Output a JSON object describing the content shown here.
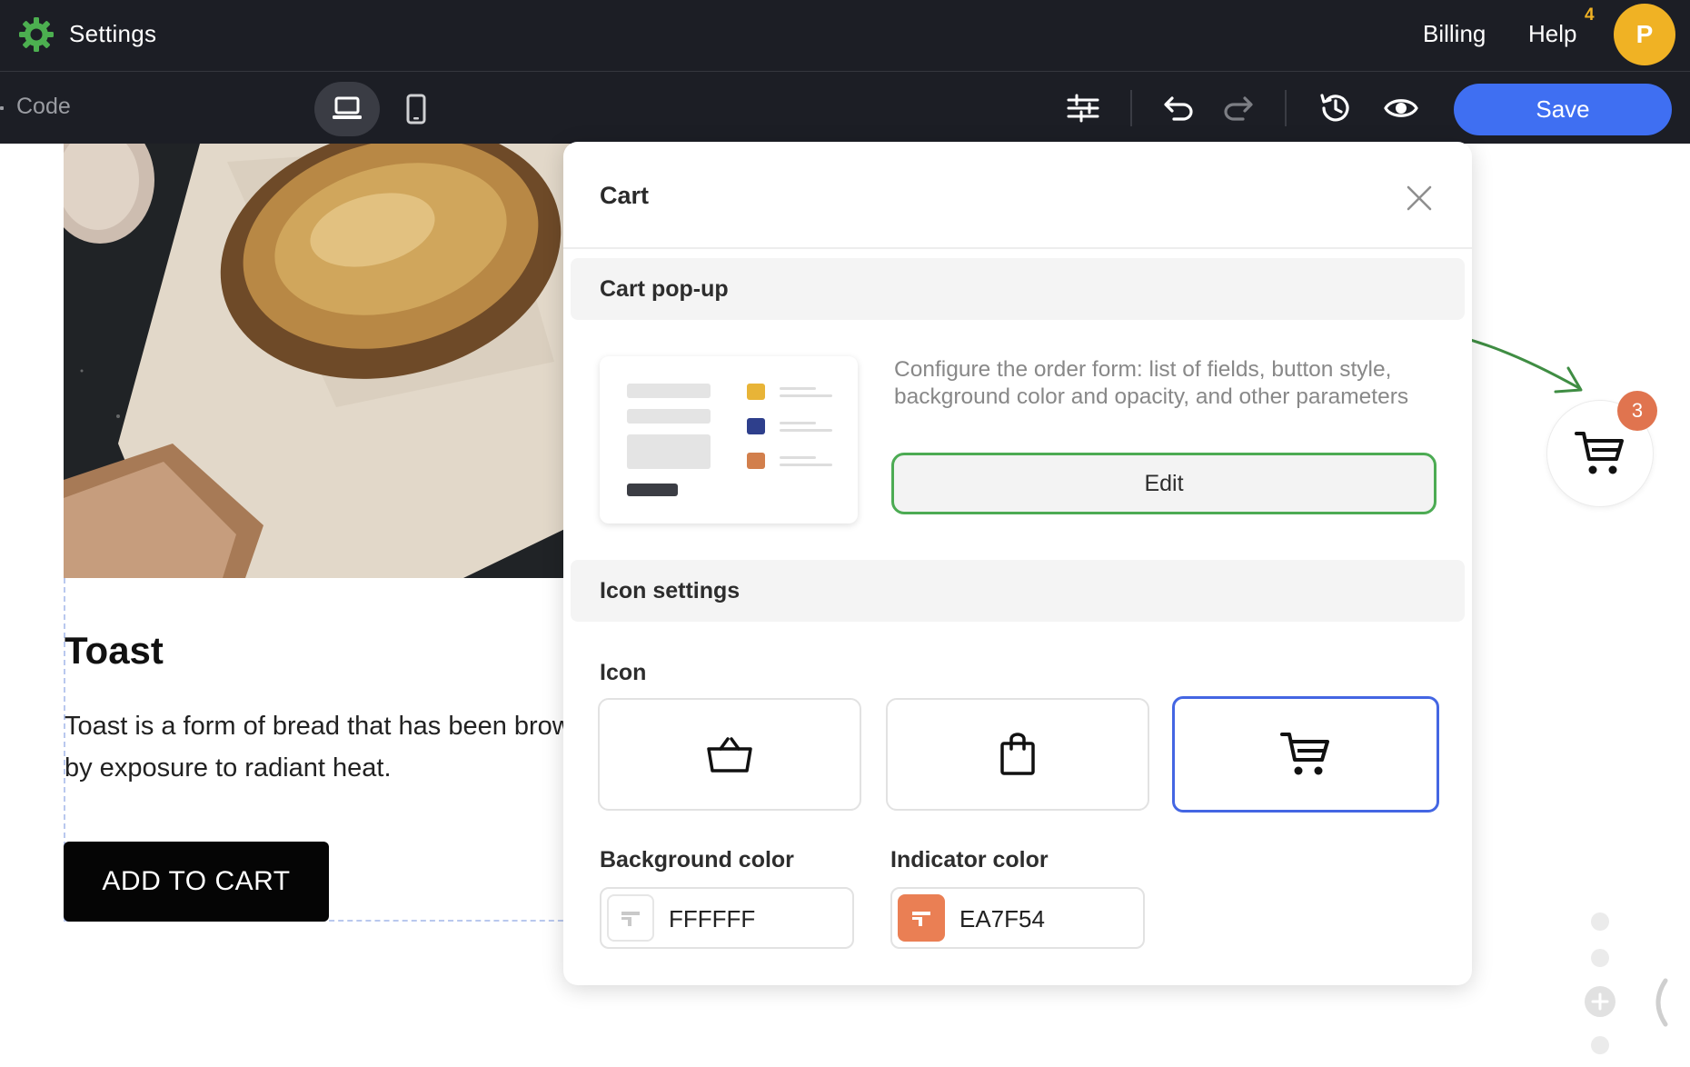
{
  "topbar": {
    "title": "Settings",
    "billing": "Billing",
    "help": "Help",
    "help_badge": "4",
    "avatar_letter": "P",
    "brand_color": "#4caf50"
  },
  "toolbar": {
    "code_tab": "Code",
    "save_label": "Save",
    "save_color": "#3f6ff2"
  },
  "product": {
    "title": "Toast",
    "description": "Toast is a form of bread that has been browned by exposure to radiant heat.",
    "button_label": "ADD TO CART"
  },
  "cart_widget": {
    "count": "3",
    "indicator_color": "#EA7F54"
  },
  "panel": {
    "title": "Cart",
    "section_popup": "Cart pop-up",
    "popup_description": "Configure the order form: list of fields, button style, background color and opacity, and other parameters",
    "edit_label": "Edit",
    "section_icon": "Icon settings",
    "icon_label": "Icon",
    "icon_options": [
      "basket-icon",
      "shopping-bag-icon",
      "shopping-cart-icon"
    ],
    "selected_icon": "shopping-cart-icon",
    "background_color_label": "Background color",
    "background_color_value": "FFFFFF",
    "indicator_color_label": "Indicator color",
    "indicator_color_value": "EA7F54"
  }
}
